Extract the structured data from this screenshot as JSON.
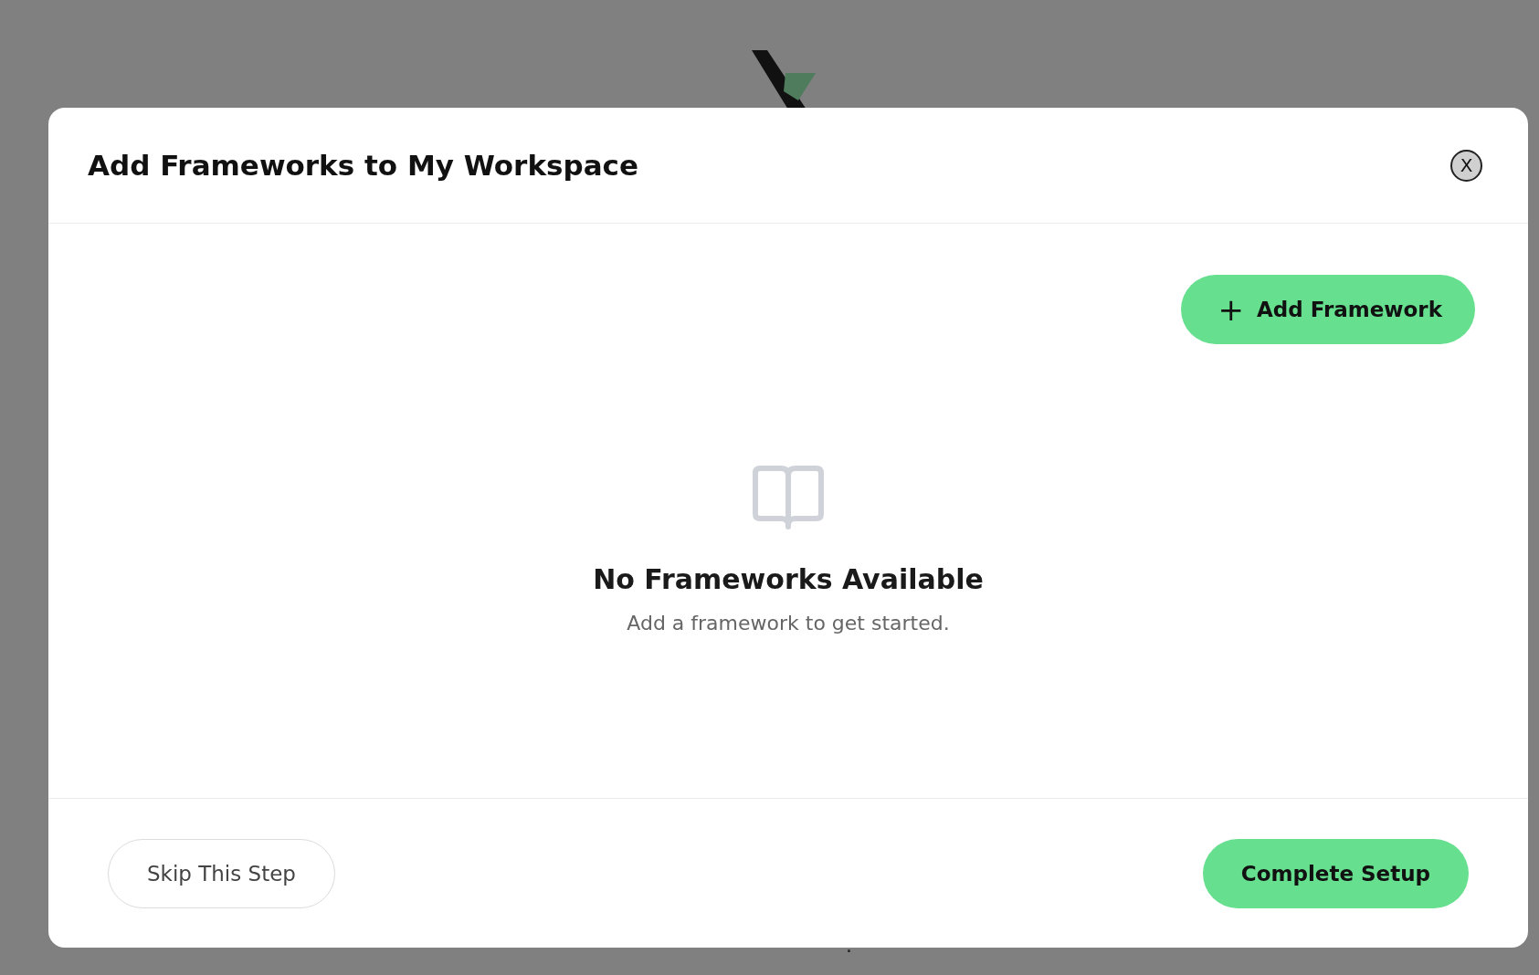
{
  "background_page": {
    "footer_punctuation": "."
  },
  "dialog": {
    "title": "Add Frameworks to My Workspace",
    "close_label": "X",
    "add_button": {
      "icon": "+",
      "label": "Add Framework"
    },
    "empty_state": {
      "title": "No Frameworks Available",
      "message": "Add a framework to get started."
    },
    "footer_buttons": [
      {
        "kind": "secondary",
        "label": "Skip This Step"
      },
      {
        "kind": "primary",
        "label": "Complete Setup"
      }
    ]
  }
}
